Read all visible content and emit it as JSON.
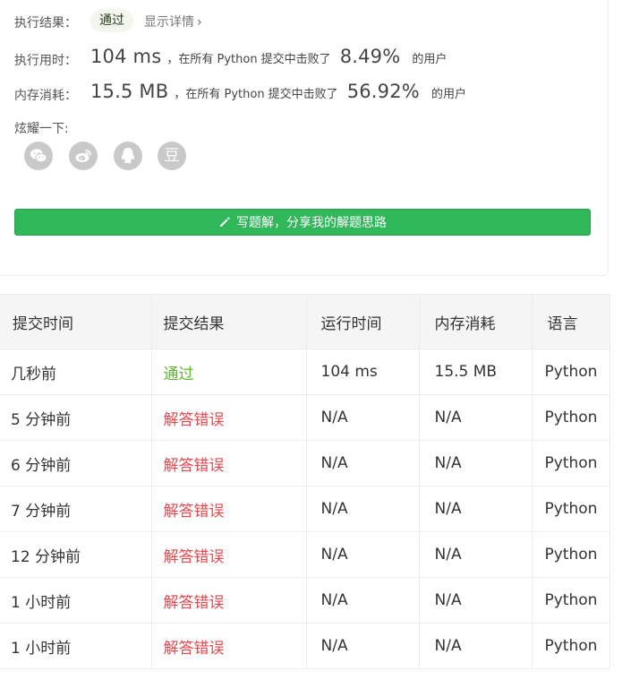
{
  "result": {
    "status_label": "执行结果：",
    "status_value": "通过",
    "details_link": "显示详情",
    "runtime_label": "执行用时：",
    "runtime_value": "104 ms",
    "runtime_text_mid": "，在所有 Python 提交中击败了",
    "runtime_percent": "8.49%",
    "runtime_text_end": "的用户",
    "memory_label": "内存消耗：",
    "memory_value": "15.5 MB",
    "memory_text_mid": "，在所有 Python 提交中击败了",
    "memory_percent": "56.92%",
    "memory_text_end": "的用户",
    "share_label": "炫耀一下:",
    "share_icons": [
      "wechat-icon",
      "weibo-icon",
      "qq-icon",
      "douban-icon"
    ],
    "share_douban_glyph": "豆",
    "write_button": "写题解，分享我的解题思路"
  },
  "colors": {
    "accent_green": "#2fb75a",
    "pass_text": "#5cb82a",
    "error_text": "#e8474c",
    "icon_gray": "#c9c9c9"
  },
  "table": {
    "headers": [
      "提交时间",
      "提交结果",
      "运行时间",
      "内存消耗",
      "语言"
    ],
    "rows": [
      {
        "time": "几秒前",
        "status": "通过",
        "status_type": "pass",
        "runtime": "104 ms",
        "memory": "15.5 MB",
        "language": "Python"
      },
      {
        "time": "5 分钟前",
        "status": "解答错误",
        "status_type": "error",
        "runtime": "N/A",
        "memory": "N/A",
        "language": "Python"
      },
      {
        "time": "6 分钟前",
        "status": "解答错误",
        "status_type": "error",
        "runtime": "N/A",
        "memory": "N/A",
        "language": "Python"
      },
      {
        "time": "7 分钟前",
        "status": "解答错误",
        "status_type": "error",
        "runtime": "N/A",
        "memory": "N/A",
        "language": "Python"
      },
      {
        "time": "12 分钟前",
        "status": "解答错误",
        "status_type": "error",
        "runtime": "N/A",
        "memory": "N/A",
        "language": "Python"
      },
      {
        "time": "1 小时前",
        "status": "解答错误",
        "status_type": "error",
        "runtime": "N/A",
        "memory": "N/A",
        "language": "Python"
      },
      {
        "time": "1 小时前",
        "status": "解答错误",
        "status_type": "error",
        "runtime": "N/A",
        "memory": "N/A",
        "language": "Python"
      }
    ]
  }
}
